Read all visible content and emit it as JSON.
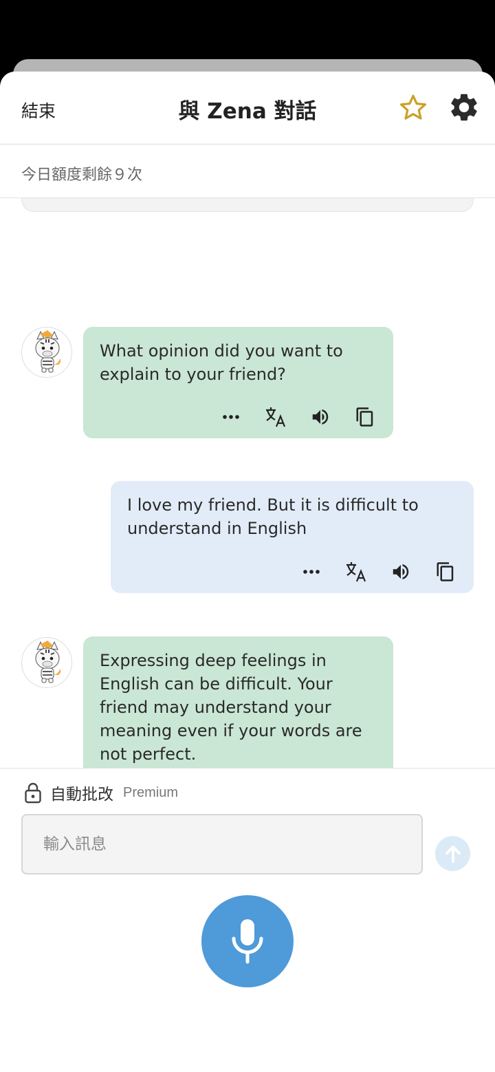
{
  "header": {
    "end_label": "結束",
    "title": "與 Zena 對話"
  },
  "quota": {
    "text": "今日額度剩餘９次"
  },
  "messages": [
    {
      "role": "assistant",
      "text": "What opinion did you want to explain to your friend?"
    },
    {
      "role": "user",
      "text": "I love my friend. But it is difficult to understand in English"
    },
    {
      "role": "assistant",
      "text": "Expressing deep feelings in English can be difficult. Your friend may understand your meaning even if your words are not perfect."
    }
  ],
  "composer": {
    "auto_correct_label": "自動批改",
    "premium_label": "Premium",
    "placeholder": "輸入訊息"
  },
  "icons": {
    "favorite": "star-outline-icon",
    "settings": "gear-icon",
    "more": "more-dots-icon",
    "translate": "translate-icon",
    "speak": "speaker-icon",
    "copy": "copy-icon",
    "lock": "lock-icon",
    "send": "arrow-up-icon",
    "mic": "microphone-icon"
  },
  "colors": {
    "star": "#c9a227",
    "bot_bubble": "#cae6d4",
    "user_bubble": "#e2ecf8",
    "mic_button": "#4f9ad9",
    "send_button": "#dbeaf7"
  }
}
